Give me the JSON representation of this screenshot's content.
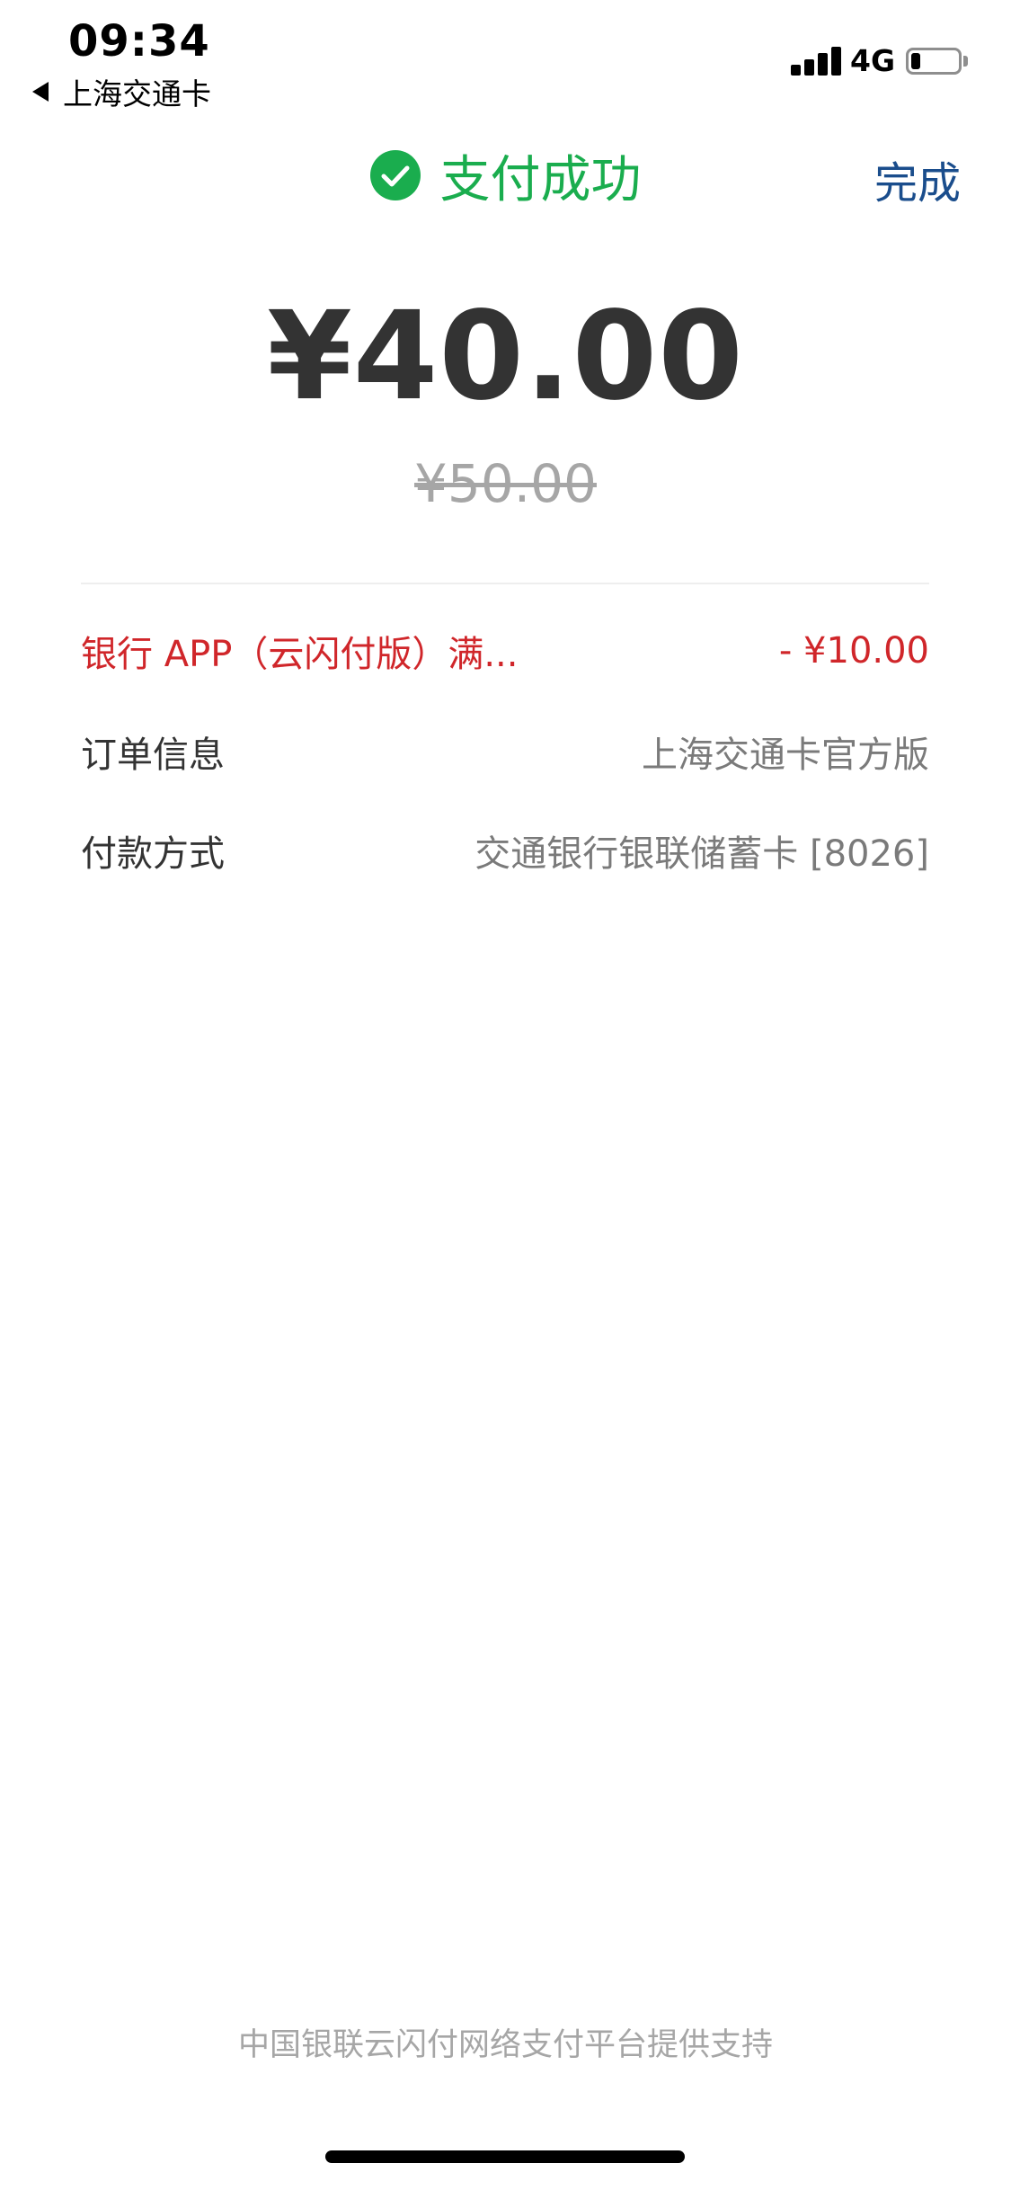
{
  "status_bar": {
    "time": "09:34",
    "back_app": "上海交通卡",
    "network": "4G",
    "battery_level": 0.2
  },
  "header": {
    "title": "支付成功",
    "done_label": "完成"
  },
  "payment": {
    "amount": "¥40.00",
    "original_amount": "¥50.00"
  },
  "details": {
    "discount_label": "银行 APP（云闪付版）满...",
    "discount_value": "- ¥10.00",
    "order_label": "订单信息",
    "order_value": "上海交通卡官方版",
    "payment_method_label": "付款方式",
    "payment_method_value": "交通银行银联储蓄卡 [8026]"
  },
  "footer": {
    "text": "中国银联云闪付网络支付平台提供支持"
  },
  "colors": {
    "success": "#1aad4e",
    "link": "#1a4d8c",
    "discount": "#d0262a"
  }
}
